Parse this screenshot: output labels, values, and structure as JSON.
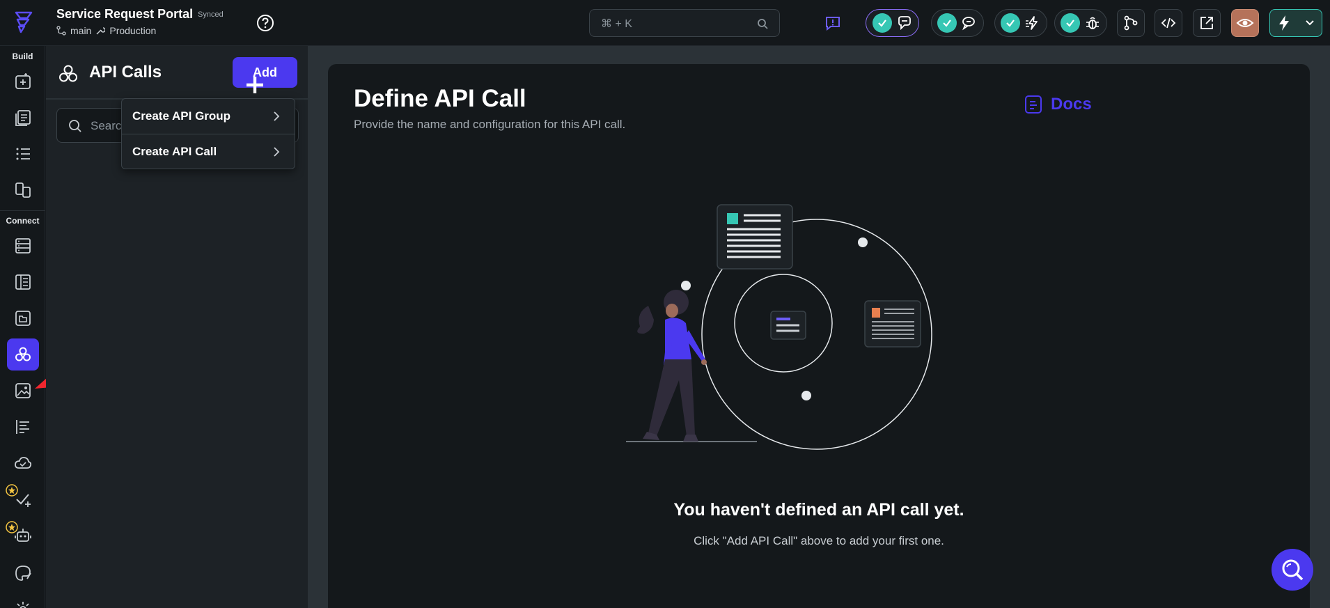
{
  "header": {
    "project_title": "Service Request Portal",
    "sync_status": "Synced",
    "branch": "main",
    "environment": "Production",
    "search_shortcut": "⌘ + K"
  },
  "rail": {
    "build_label": "Build",
    "connect_label": "Connect"
  },
  "panel": {
    "title": "API Calls",
    "add_label": "Add",
    "search_placeholder": "Search"
  },
  "menu": {
    "items": [
      {
        "label": "Create API Group"
      },
      {
        "label": "Create API Call"
      }
    ]
  },
  "main": {
    "title": "Define API Call",
    "subtitle": "Provide the name and configuration for this API call.",
    "docs_label": "Docs",
    "empty_title": "You haven't defined an API call yet.",
    "empty_subtitle": "Click \"Add API Call\" above to add your first one."
  },
  "colors": {
    "accent": "#4b39ef",
    "success": "#36c7b4",
    "background": "#14181b",
    "panel": "#1d2226"
  },
  "icons": [
    "logo-icon",
    "help-icon",
    "search-icon",
    "feedback-icon",
    "check-icon",
    "chat-icon",
    "bolt-icon",
    "bug-icon",
    "branch-icon",
    "code-icon",
    "external-link-icon",
    "eye-icon",
    "lightning-icon",
    "chevron-down-icon"
  ]
}
